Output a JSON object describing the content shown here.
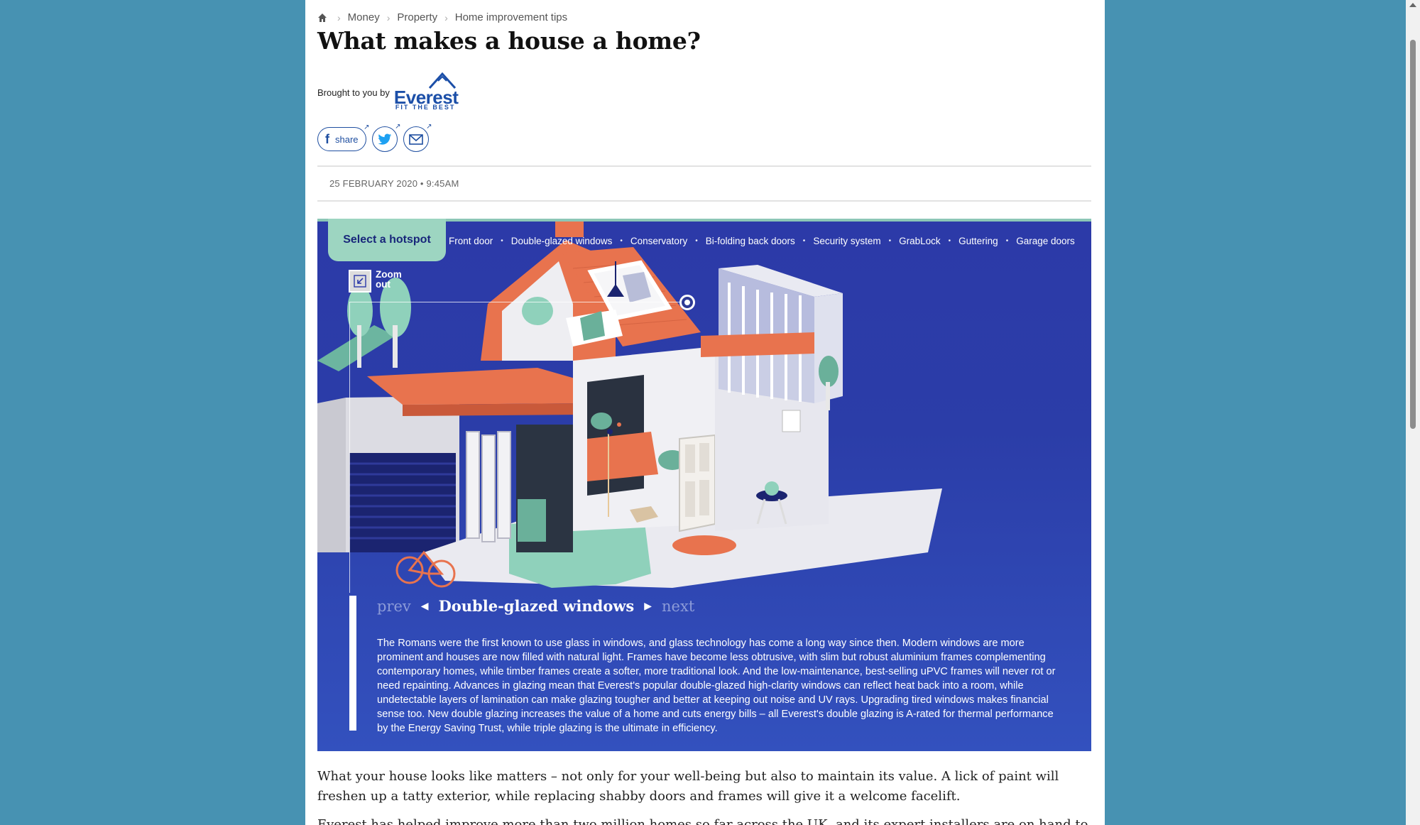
{
  "breadcrumb": {
    "items": [
      "Money",
      "Property",
      "Home improvement tips"
    ]
  },
  "article": {
    "title": "What makes a house a home?",
    "sponsor_label": "Brought to you by",
    "sponsor_name": "Everest",
    "sponsor_tagline": "FIT THE BEST",
    "date": "25 FEBRUARY 2020 • 9:45AM",
    "paragraph1": "What your house looks like matters – not only for your well-being but also to maintain its value. A lick of paint will freshen up a tatty exterior, while replacing shabby doors and frames will give it a welcome facelift.",
    "paragraph2": "Everest has helped improve more than two million homes so far across the UK, and its expert installers are on hand to help you."
  },
  "share": {
    "facebook_label": "share",
    "facebook_glyph": "f"
  },
  "interactive": {
    "select_label": "Select a hotspot",
    "hotspots": [
      "Front door",
      "Double-glazed windows",
      "Conservatory",
      "Bi-folding back doors",
      "Security system",
      "GrabLock",
      "Guttering",
      "Garage doors"
    ],
    "zoom_label_1": "Zoom",
    "zoom_label_2": "out",
    "prev_label": "prev",
    "next_label": "next",
    "current_title": "Double-glazed windows",
    "description": "The Romans were the first known to use glass in windows, and glass technology has come a long way since then. Modern windows are more prominent and houses are now filled with natural light. Frames have become less obtrusive, with slim but robust aluminium frames complementing contemporary homes, while timber frames create a softer, more traditional look. And the low-maintenance, best-selling uPVC frames will never rot or need repainting. Advances in glazing mean that Everest's popular double-glazed high-clarity windows can reflect heat back into a room, while undetectable layers of lamination can make glazing tougher and better at keeping out noise and UV rays. Upgrading tired windows makes financial sense too. New double glazing increases the value of a home and cuts energy bills – all Everest's double glazing is A-rated for thermal performance by the Energy Saving Trust, while triple glazing is the ultimate in efficiency."
  },
  "colors": {
    "background": "#4792b2",
    "brand_blue": "#1c4fa8",
    "hero_blue": "#2c3aa8",
    "mint": "#9dd5c1",
    "roof_orange": "#e8734e"
  },
  "icons": [
    "home-icon",
    "facebook-icon",
    "twitter-icon",
    "email-icon",
    "zoom-out-icon",
    "triangle-left-icon",
    "triangle-right-icon",
    "mountain-logo-icon"
  ]
}
